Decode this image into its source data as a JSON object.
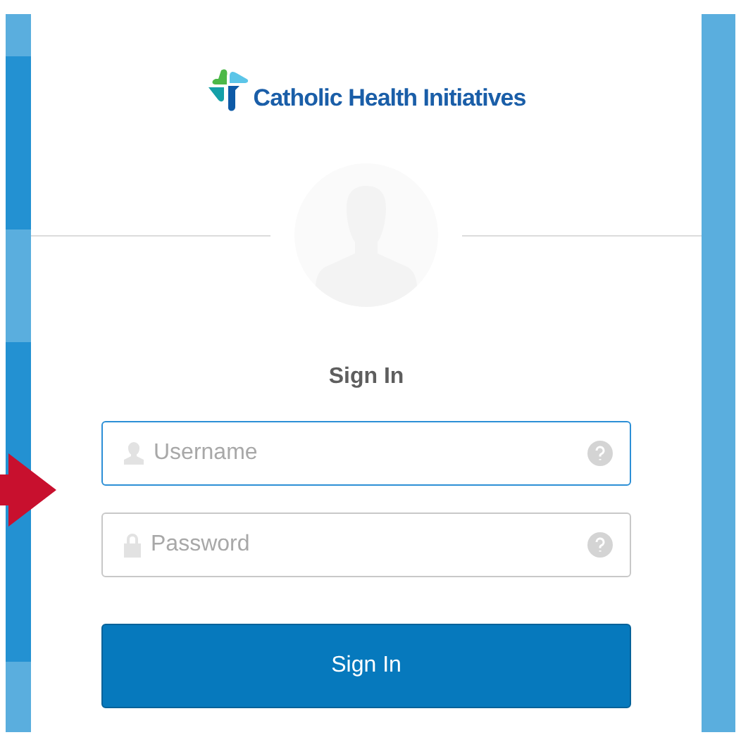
{
  "logo": {
    "text": "Catholic Health Initiatives"
  },
  "title": "Sign In",
  "fields": [
    {
      "kind": "user",
      "placeholder": "Username",
      "focused": true
    },
    {
      "kind": "lock",
      "placeholder": "Password",
      "focused": false
    }
  ],
  "button": {
    "label": "Sign In"
  }
}
